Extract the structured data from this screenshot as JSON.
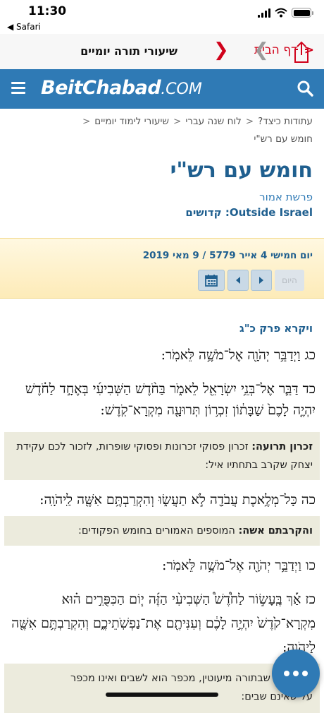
{
  "status": {
    "time": "11:30",
    "back_label": "◀ Safari"
  },
  "toolbar": {
    "home_label": "דף הבית",
    "title": "שיעורי תורה יומיים"
  },
  "header": {
    "logo_main": "BeitChabad",
    "logo_suffix": ".COM"
  },
  "breadcrumb": {
    "items": [
      "עתודות כיצד?",
      "לוח שנה עברי",
      "שיעורי לימוד יומיים",
      "חומש עם רש\"י"
    ]
  },
  "page": {
    "title": "חומש עם רש\"י",
    "parasha": "פרשת אמור",
    "location": "Outside Israel: קדושים"
  },
  "date_bar": {
    "date_text": "יום חמישי 4 אייר 5779 / 9 מאי 2019",
    "today_label": "היום"
  },
  "content": {
    "chapter_heading": "ויקרא פרק כ\"ג",
    "verse_23_num": "כג",
    "verse_23": "וַיְדַבֵּ֥ר יְהֹוָ֖ה אֶל־מֹשֶׁ֥ה לֵּאמֹֽר:",
    "verse_24_num": "כד",
    "verse_24": "דַּבֵּ֛ר אֶל־בְּנֵ֥י יִשְׂרָאֵ֖ל לֵאמֹ֑ר בַּחֹ֨דֶשׁ הַשְּׁבִיעִ֜י בְּאֶחָ֣ד לַחֹ֗דֶשׁ יִהְיֶ֤ה לָכֶם֙ שַׁבָּת֔וֹן זִכְר֥וֹן תְּרוּעָ֖ה מִקְרָא־קֹֽדֶשׁ:",
    "comment_1_dh": "זכרון תרועה:",
    "comment_1_text": "זכרון פסוקי זכרונות ופסוקי שופרות, לזכור לכם עקידת יצחק שקרב בתחתיו איל:",
    "verse_25_num": "כה",
    "verse_25": "כָּל־מְלֶ֥אכֶת עֲבֹדָ֖ה לֹ֣א תַעֲשׂ֑וּ וְהִקְרַבְתֶּ֥ם אִשֶּׁ֖ה לַֽיהֹוָֽה:",
    "comment_2_dh": "והקרבתם אשה:",
    "comment_2_text": "המוספים האמורים בחומש הפקודים:",
    "verse_26_num": "כו",
    "verse_26": "וַיְדַבֵּ֥ר יְהֹוָ֖ה אֶל־מֹשֶׁ֥ה לֵּאמֹֽר:",
    "verse_27_num": "כז",
    "verse_27": "אַ֡ךְ בֶּֽעָשׂ֣וֹר לַחֹ֩דֶשׁ֩ הַשְּׁבִיעִ֨י הַזֶּ֜ה י֧וֹם הַכִּפֻּרִ֣ים ה֗וּא מִקְרָא־קֹ֙דֶשׁ֙ יִהְיֶ֣ה לָכֶ֔ם וְעִנִּיתֶ֖ם אֶת־נַפְשֹֽׁתֵיכֶ֑ם וְהִקְרַבְתֶּ֥ם אִשֶּׁ֖ה לַיהֹוָֽה:",
    "comment_3_text": "אכן ורקין שבתורה מיעוטין, מכפר הוא לשבים ואינו מכפר על שאינם שבים:"
  },
  "colors": {
    "brand_blue": "#2f7ab5",
    "nav_red": "#d0021b",
    "commentary_bg": "#ecebdd"
  }
}
